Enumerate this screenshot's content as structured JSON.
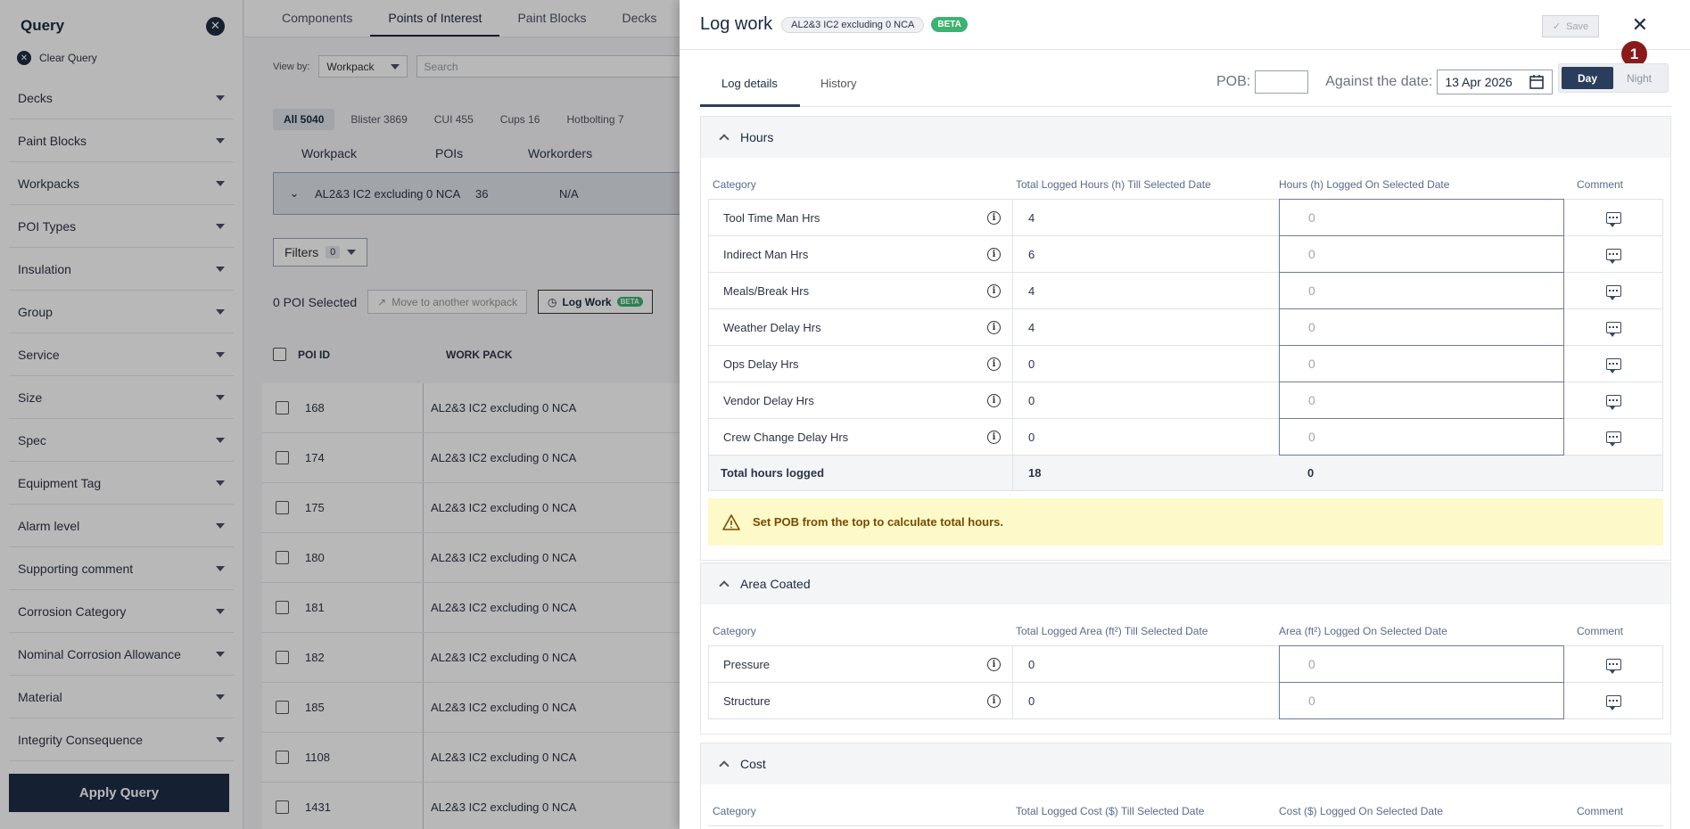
{
  "sidebar": {
    "title": "Query",
    "clear_label": "Clear Query",
    "items": [
      "Decks",
      "Paint Blocks",
      "Workpacks",
      "POI Types",
      "Insulation",
      "Group",
      "Service",
      "Size",
      "Spec",
      "Equipment Tag",
      "Alarm level",
      "Supporting comment",
      "Corrosion Category",
      "Nominal Corrosion Allowance",
      "Material",
      "Integrity Consequence"
    ],
    "apply_label": "Apply Query"
  },
  "main": {
    "tabs": [
      "Components",
      "Points of Interest",
      "Paint Blocks",
      "Decks"
    ],
    "active_tab": "Points of Interest",
    "view_by_label": "View by:",
    "view_by_value": "Workpack",
    "search_placeholder": "Search",
    "chips": [
      "All 5040",
      "Blister 3869",
      "CUI 455",
      "Cups 16",
      "Hotbolting 7"
    ],
    "wp_headers": [
      "Workpack",
      "POIs",
      "Workorders"
    ],
    "wp_row": {
      "name": "AL2&3 IC2 excluding 0 NCA",
      "pois": "36",
      "workorders": "N/A"
    },
    "filters_label": "Filters",
    "filters_count": "0",
    "selected_label": "0 POI Selected",
    "move_label": "Move to another workpack",
    "log_work_label": "Log Work",
    "beta_small": "BETA",
    "poi_headers": [
      "POI ID",
      "WORK PACK"
    ],
    "poi_rows": [
      {
        "id": "168",
        "wp": "AL2&3 IC2 excluding 0 NCA"
      },
      {
        "id": "174",
        "wp": "AL2&3 IC2 excluding 0 NCA"
      },
      {
        "id": "175",
        "wp": "AL2&3 IC2 excluding 0 NCA"
      },
      {
        "id": "180",
        "wp": "AL2&3 IC2 excluding 0 NCA"
      },
      {
        "id": "181",
        "wp": "AL2&3 IC2 excluding 0 NCA"
      },
      {
        "id": "182",
        "wp": "AL2&3 IC2 excluding 0 NCA"
      },
      {
        "id": "185",
        "wp": "AL2&3 IC2 excluding 0 NCA"
      },
      {
        "id": "1108",
        "wp": "AL2&3 IC2 excluding 0 NCA"
      },
      {
        "id": "1431",
        "wp": "AL2&3 IC2 excluding 0 NCA"
      }
    ]
  },
  "drawer": {
    "title": "Log work",
    "workpack_tag": "AL2&3 IC2 excluding 0 NCA",
    "beta": "BETA",
    "save_label": "Save",
    "marker": "1",
    "tabs": [
      "Log details",
      "History"
    ],
    "pob_label": "POB:",
    "pob_value": "",
    "date_label": "Against the date:",
    "date_value": "13 Apr 2026",
    "shift": {
      "day": "Day",
      "night": "Night",
      "selected": "Day"
    },
    "hours": {
      "title": "Hours",
      "columns": [
        "Category",
        "Total Logged Hours (h) Till Selected Date",
        "Hours (h) Logged On Selected Date",
        "Comment"
      ],
      "rows": [
        {
          "category": "Tool Time Man Hrs",
          "total": "4",
          "placeholder": "0"
        },
        {
          "category": "Indirect Man Hrs",
          "total": "6",
          "placeholder": "0"
        },
        {
          "category": "Meals/Break Hrs",
          "total": "4",
          "placeholder": "0"
        },
        {
          "category": "Weather Delay Hrs",
          "total": "4",
          "placeholder": "0"
        },
        {
          "category": "Ops Delay Hrs",
          "total": "0",
          "placeholder": "0"
        },
        {
          "category": "Vendor Delay Hrs",
          "total": "0",
          "placeholder": "0"
        },
        {
          "category": "Crew Change Delay Hrs",
          "total": "0",
          "placeholder": "0"
        }
      ],
      "total_label": "Total hours logged",
      "total_value": "18",
      "total_selected": "0",
      "warning": "Set POB from the top to calculate total hours."
    },
    "area": {
      "title": "Area Coated",
      "columns": [
        "Category",
        "Total Logged Area (ft²) Till Selected Date",
        "Area (ft²) Logged On Selected Date",
        "Comment"
      ],
      "rows": [
        {
          "category": "Pressure",
          "total": "0",
          "placeholder": "0"
        },
        {
          "category": "Structure",
          "total": "0",
          "placeholder": "0"
        }
      ]
    },
    "cost": {
      "title": "Cost",
      "columns": [
        "Category",
        "Total Logged Cost ($) Till Selected Date",
        "Cost ($) Logged On Selected Date",
        "Comment"
      ]
    }
  }
}
